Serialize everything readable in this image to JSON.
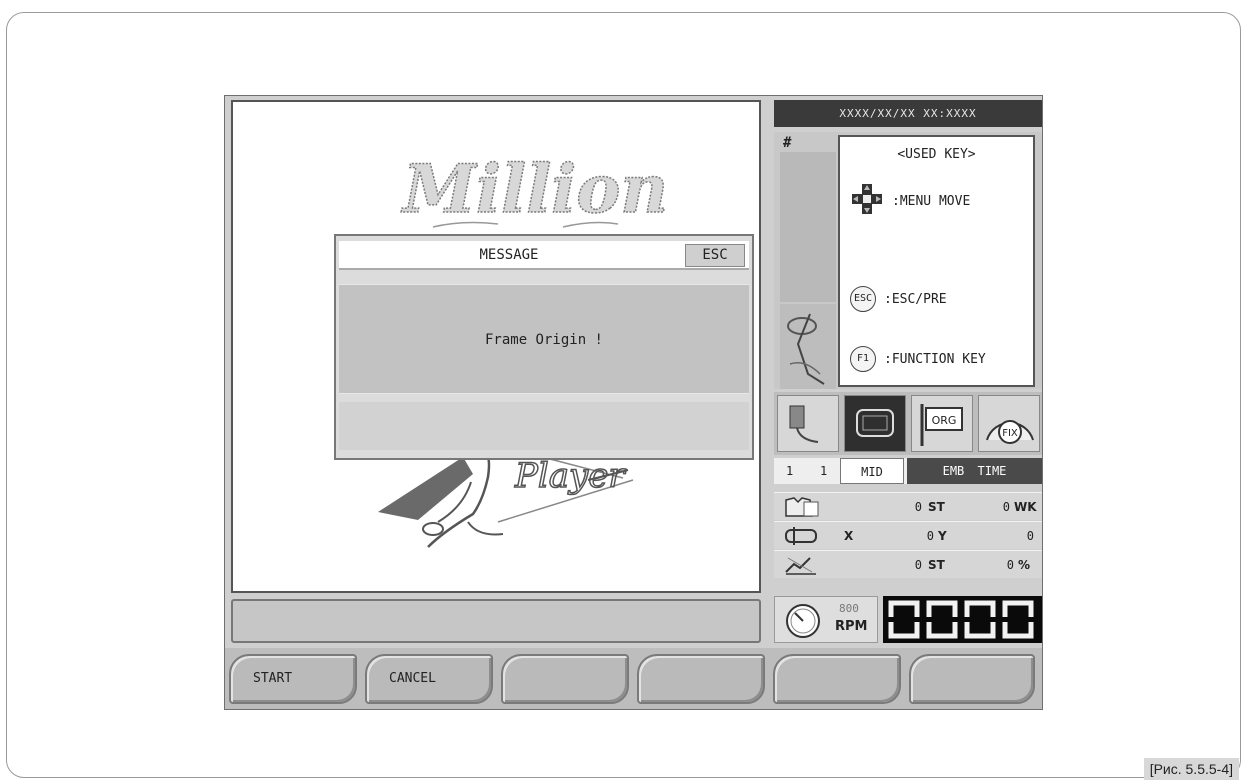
{
  "caption": "[Рис. 5.5.5-4]",
  "header": {
    "datetime": "XXXX/XX/XX XX:XXXX"
  },
  "design": {
    "logo_text": "Million",
    "sub_text": "Player"
  },
  "dialog": {
    "title": "MESSAGE",
    "esc_label": "ESC",
    "message": "Frame Origin !"
  },
  "info": {
    "hash": "#",
    "used_key_title": "<USED KEY>",
    "keys": [
      {
        "icon": "dpad-icon",
        "label": ":MENU MOVE"
      },
      {
        "icon": "esc-key-icon",
        "key": "ESC",
        "label": ":ESC/PRE"
      },
      {
        "icon": "f1-key-icon",
        "key": "F1",
        "label": ":FUNCTION KEY"
      }
    ]
  },
  "modes": {
    "icons": [
      "frame-thread-icon",
      "frame-icon",
      "origin-icon",
      "fix-gauge-icon"
    ],
    "orc_label": "ORG",
    "fix_label": "FIX",
    "num1": "1",
    "num2": "1",
    "mid": "MID",
    "emb_time": "EMB TIME"
  },
  "stats": {
    "st1": "0",
    "st1_unit": "ST",
    "wk": "0",
    "wk_unit": "WK",
    "x_label": "X",
    "y_val": "0",
    "y_label": "Y",
    "x_val": "0",
    "st2": "0",
    "st2_unit": "ST",
    "pct": "0",
    "pct_unit": "%"
  },
  "speed": {
    "rpm_value": "800",
    "rpm_unit": "RPM"
  },
  "buttons": [
    "START",
    "CANCEL",
    "",
    "",
    "",
    ""
  ],
  "colors": {
    "led_bg": "#0a0a0a",
    "panel": "#c8c8c8",
    "accent_dark": "#3a3a3a"
  }
}
